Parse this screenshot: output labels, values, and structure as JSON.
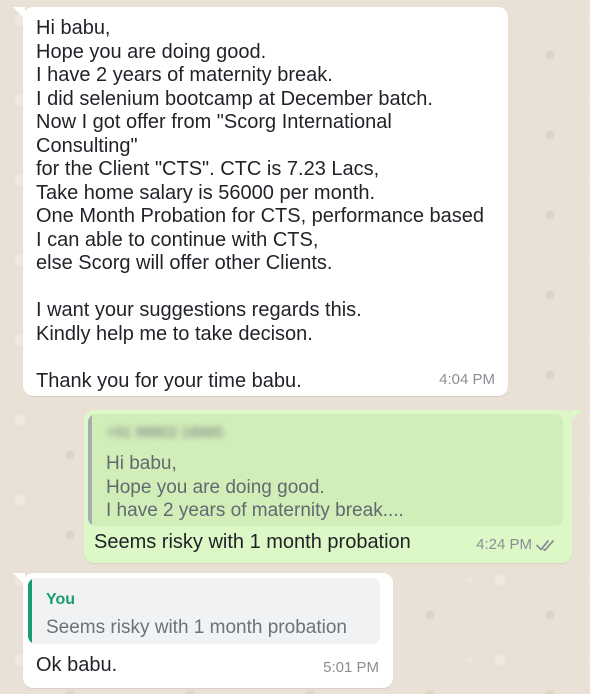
{
  "messages": [
    {
      "direction": "incoming",
      "text": "Hi babu,\nHope you are doing good.\nI have 2 years of maternity break.\nI did selenium bootcamp at December batch.\nNow I got offer from \"Scorg International\nConsulting\"\nfor the Client \"CTS\". CTC is 7.23 Lacs,\nTake home salary is 56000 per month.\nOne Month Probation for CTS, performance based\nI can able to continue with CTS,\nelse Scorg will offer other Clients.\n\nI want your suggestions regards this.\nKindly help me to take decison.\n\nThank you for your time babu.",
      "time": "4:04 PM"
    },
    {
      "direction": "outgoing",
      "quote": {
        "sender": "+91 98802 18985",
        "text": "Hi babu,\nHope you are doing good.\nI have 2 years of maternity break...."
      },
      "text": "Seems risky with 1 month probation",
      "time": "4:24 PM",
      "status_icon": "double-check-icon"
    },
    {
      "direction": "incoming",
      "quote": {
        "sender": "You",
        "text": "Seems risky with 1 month probation"
      },
      "text": "Ok babu.",
      "time": "5:01 PM"
    }
  ],
  "colors": {
    "wallpaper": "#e9e1d6",
    "incoming_bubble": "#ffffff",
    "outgoing_bubble": "#dcf8c6",
    "quote_accent_you": "#1a9c73",
    "time_text": "#8b8f94"
  }
}
